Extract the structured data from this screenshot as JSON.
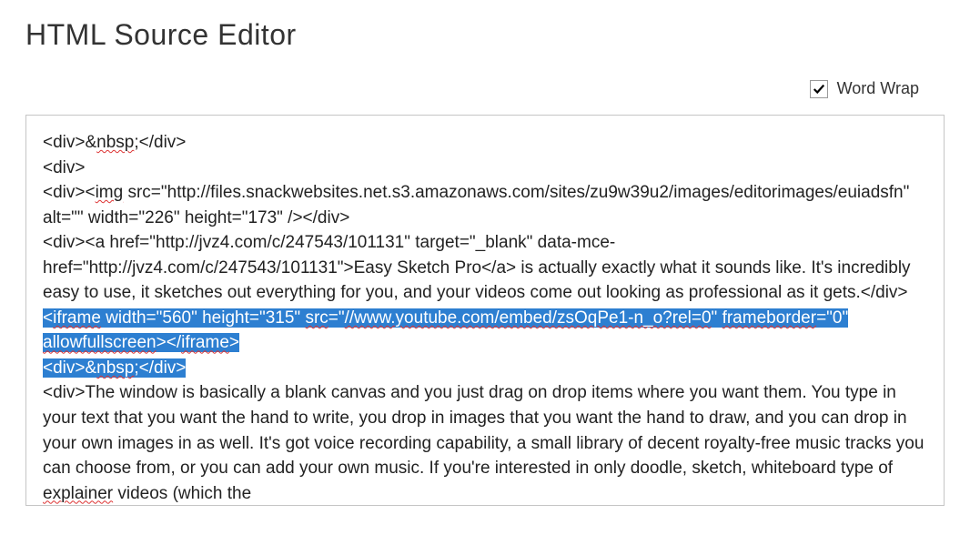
{
  "header": {
    "title": "HTML Source Editor"
  },
  "options": {
    "wordwrap_label": "Word Wrap",
    "wordwrap_checked": true
  },
  "source": {
    "l1_a": "<div>&",
    "l1_b": "nbsp",
    "l1_c": ";</div>",
    "l2": "<div>",
    "l3_a": "<div><",
    "l3_b": "img",
    "l3_c": " src=\"http://files.snackwebsites.net.s3.amazonaws.com/sites/zu9w39u2/images/editorimages/euiadsfn\" alt=\"\" width=\"226\" height=\"173\" /></div>",
    "l4": "<div><a href=\"http://jvz4.com/c/247543/101131\" target=\"_blank\" data-mce-href=\"http://jvz4.com/c/247543/101131\">Easy Sketch Pro</a> is actually exactly what it sounds like. It's incredibly easy to use, it sketches out everything for you, and your videos come out looking as professional as it gets.</div>",
    "sel1_a": "<",
    "sel1_b": "iframe",
    "sel1_c": " width=\"560\" height=\"315\" ",
    "sel1_d": "src",
    "sel1_e": "=\"",
    "sel1_f": "//www.youtube.com/embed/zsOqPe1-n_o?rel=0",
    "sel1_g": "\" ",
    "sel1_h": "frameborder",
    "sel1_i": "=\"0\" ",
    "sel1_j": "allowfullscreen",
    "sel1_k": "></",
    "sel1_l": "iframe",
    "sel1_m": ">",
    "sel2_a": "<div>&",
    "sel2_b": "nbsp",
    "sel2_c": ";</div>",
    "l7_a": "<div>The window is basically a blank canvas and you just drag on drop items where you want them. You type in your text that you want the hand to write, you drop in images that you want the hand to draw, and you can drop in your own images in as well. It's got voice recording capability, a small library of decent royalty-free music tracks you can choose from, or you can add your own music. If you're interested in only doodle, sketch, whiteboard type of ",
    "l7_b": "explainer",
    "l7_c": " videos (which the"
  }
}
